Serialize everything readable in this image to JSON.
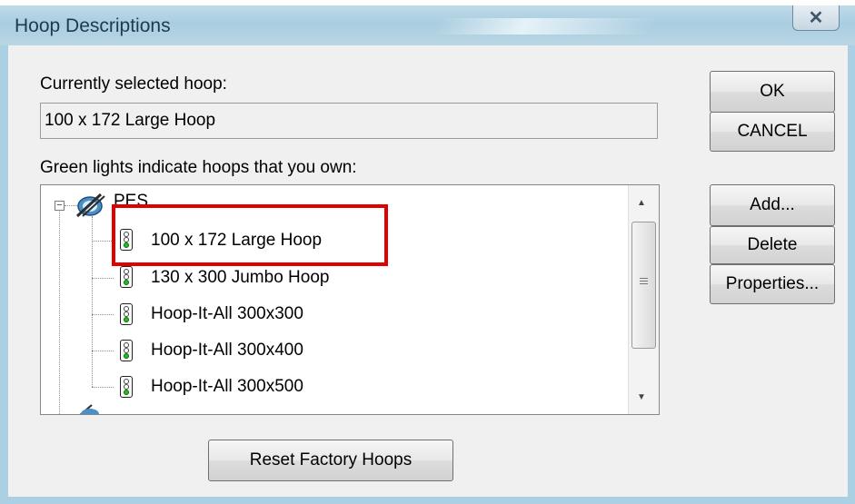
{
  "window": {
    "title": "Hoop Descriptions",
    "close_glyph": "✕",
    "close_icon": "close-icon"
  },
  "current": {
    "label": "Currently selected hoop:",
    "value": "100 x 172 Large Hoop"
  },
  "list": {
    "label": "Green lights indicate hoops that you own:",
    "root": {
      "label": "PES",
      "icon": "hoop-category-icon",
      "expanded": true
    },
    "items": [
      {
        "label": "100 x 172 Large Hoop",
        "owned": true,
        "highlighted": true
      },
      {
        "label": "130 x 300 Jumbo Hoop",
        "owned": true
      },
      {
        "label": "Hoop-It-All 300x300",
        "owned": true
      },
      {
        "label": "Hoop-It-All 300x400",
        "owned": true
      },
      {
        "label": "Hoop-It-All 300x500",
        "owned": true
      }
    ],
    "owned_light_color": "#1fc01f"
  },
  "buttons": {
    "ok": "OK",
    "cancel": "CANCEL",
    "add": "Add...",
    "delete": "Delete",
    "properties": "Properties...",
    "reset": "Reset Factory Hoops"
  },
  "colors": {
    "highlight_box": "#e00000",
    "title_bar": "#a9cde0"
  }
}
